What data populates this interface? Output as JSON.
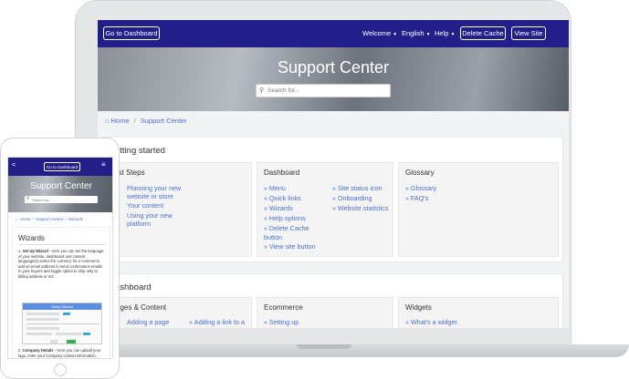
{
  "desktop": {
    "nav": {
      "dashboard_button": "Go to Dashboard",
      "welcome": "Welcome",
      "language": "English",
      "help": "Help",
      "delete_cache": "Delete Cache",
      "view_site": "View Site"
    },
    "hero": {
      "title": "Support Center",
      "search_placeholder": "Search for..."
    },
    "breadcrumb": {
      "home": "Home",
      "current": "Support Center"
    },
    "getting_started": {
      "title": "etting started",
      "first_steps": {
        "title": "rst Steps",
        "links": [
          "Planning your new website or store",
          "Your content",
          "Using your new platform"
        ]
      },
      "dashboard": {
        "title": "Dashboard",
        "col1": [
          "Menu",
          "Quick links",
          "Wizards",
          "Help options",
          "Delete Cache button",
          "View site button"
        ],
        "col2": [
          "Site status icon",
          "Onboarding",
          "Website statistics"
        ]
      },
      "glossary": {
        "title": "Glossary",
        "links": [
          "Glossary",
          "FAQ's"
        ]
      }
    },
    "dashboard_section": {
      "title": "ashboard",
      "pages": {
        "title": "ages & Content",
        "links": [
          "Adding a page",
          "Adding a link to a"
        ]
      },
      "ecommerce": {
        "title": "Ecommerce",
        "links": [
          "Setting up"
        ]
      },
      "widgets": {
        "title": "Widgets",
        "links": [
          "What's a widget"
        ]
      }
    }
  },
  "mobile": {
    "back": "<",
    "dashboard_button": "Go to Dashboard",
    "hero_title": "Support Center",
    "search_placeholder": "Search for...",
    "breadcrumb": [
      "Home",
      "Support Center",
      "Wizards"
    ],
    "page_title": "Wizards",
    "step1_prefix": "1. ",
    "step1_bold": "Set Up Wizard",
    "step1_text": " - Here you can set the language of your website, dashboard and content language(s) select the currency for e-commerce, add an email address to send confirmation emails to your buyers and toggle option to ship only to billing address or not.",
    "wizard_header": "Setup Wizard",
    "step2_prefix": "2. ",
    "step2_bold": "Company Details",
    "step2_text": " - Here you can upload your logo, enter your Company contact information, Company"
  },
  "colors": {
    "nav": "#221f8b",
    "link": "#4a6fd1",
    "card": "#f4f4f5"
  }
}
